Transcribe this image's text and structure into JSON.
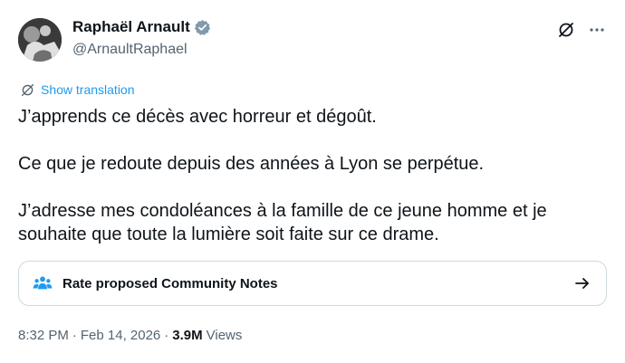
{
  "author": {
    "display_name": "Raphaël Arnault",
    "handle": "@ArnaultRaphael",
    "verified_icon": "verified-badge-icon"
  },
  "actions": {
    "grok_icon": "grok-icon",
    "more_icon": "more-options-icon"
  },
  "translation": {
    "label": "Show translation",
    "icon": "translate-icon"
  },
  "tweet": {
    "paragraphs": [
      "J’apprends ce décès avec horreur et dégoût.",
      "Ce que je redoute depuis des années à Lyon se perpétue.",
      "J’adresse mes condoléances à la famille de ce jeune homme et je souhaite que toute la lumière soit faite sur ce drame."
    ]
  },
  "community_notes": {
    "label": "Rate proposed Community Notes",
    "icon": "people-icon",
    "arrow_icon": "arrow-right-icon"
  },
  "meta": {
    "time": "8:32 PM",
    "separator": "·",
    "date": "Feb 14, 2026",
    "views_count": "3.9M",
    "views_label": "Views"
  },
  "colors": {
    "accent": "#1d9bf0",
    "text": "#0f1419",
    "secondary": "#536471",
    "border": "#cfd9de"
  }
}
